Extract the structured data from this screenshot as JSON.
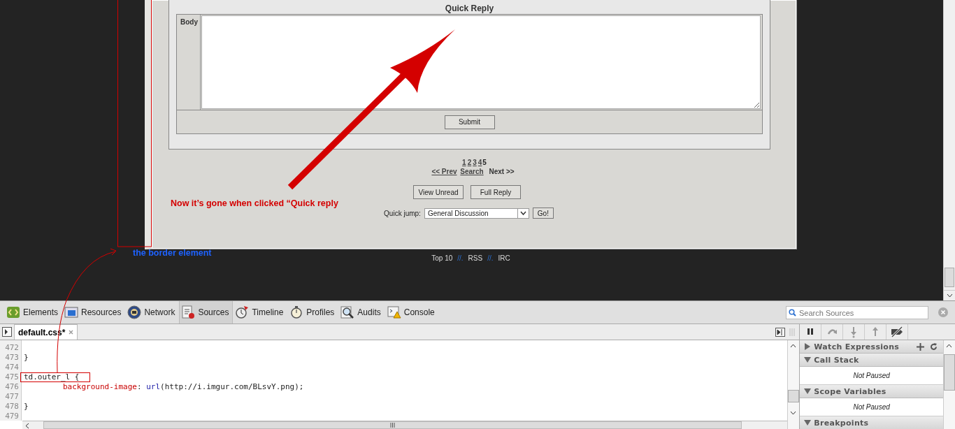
{
  "page": {
    "quick_reply": {
      "title": "Quick Reply",
      "body_label": "Body",
      "submit": "Submit"
    },
    "pages": [
      {
        "label": "1",
        "selected": false
      },
      {
        "label": "2",
        "selected": false
      },
      {
        "label": "3",
        "selected": false
      },
      {
        "label": "4",
        "selected": false
      },
      {
        "label": "5",
        "selected": true
      }
    ],
    "nav": [
      {
        "label": "<< Prev",
        "kind": "link"
      },
      {
        "label": "Search",
        "kind": "link"
      },
      {
        "label": "Next >>",
        "kind": "text"
      }
    ],
    "buttons": [
      "View Unread",
      "Full Reply"
    ],
    "quick_jump": {
      "label": "Quick jump:",
      "value": "General Discussion",
      "button": "Go!"
    },
    "footer": [
      {
        "label": "Top 10",
        "kind": "link"
      },
      {
        "label": "//.",
        "kind": "separator"
      },
      {
        "label": "RSS",
        "kind": "link"
      },
      {
        "label": "//.",
        "kind": "separator"
      },
      {
        "label": "IRC",
        "kind": "link"
      }
    ]
  },
  "annotations": {
    "note": "Now it’s gone when clicked “Quick reply",
    "border_label": "the border element"
  },
  "devtools": {
    "tabs": [
      {
        "label": "Elements",
        "selected": false
      },
      {
        "label": "Resources",
        "selected": false
      },
      {
        "label": "Network",
        "selected": false
      },
      {
        "label": "Sources",
        "selected": true
      },
      {
        "label": "Timeline",
        "selected": false
      },
      {
        "label": "Profiles",
        "selected": false
      },
      {
        "label": "Audits",
        "selected": false
      },
      {
        "label": "Console",
        "selected": false
      }
    ],
    "search": {
      "placeholder": "Search Sources"
    },
    "file_tab": "default.css*",
    "code_lines": [
      {
        "number": "472"
      },
      {
        "number": "473",
        "tokens": [
          {
            "text": "}",
            "kind": "plain"
          }
        ]
      },
      {
        "number": "474"
      },
      {
        "number": "475",
        "highlighted": true,
        "tokens": [
          {
            "text": "td.outer_l {",
            "kind": "plain"
          }
        ]
      },
      {
        "number": "476",
        "indented": true,
        "tokens": [
          {
            "text": "background-image",
            "kind": "property"
          },
          {
            "text": ": ",
            "kind": "plain"
          },
          {
            "text": "url",
            "kind": "value"
          },
          {
            "text": "(http://i.imgur.com/BLsvY.png);",
            "kind": "plain"
          }
        ]
      },
      {
        "number": "477"
      },
      {
        "number": "478",
        "tokens": [
          {
            "text": "}",
            "kind": "plain"
          }
        ]
      },
      {
        "number": "479"
      }
    ],
    "sections": [
      {
        "title": "Watch Expressions",
        "expanded": false
      },
      {
        "title": "Call Stack",
        "expanded": true,
        "content": "Not Paused"
      },
      {
        "title": "Scope Variables",
        "expanded": true,
        "content": "Not Paused"
      },
      {
        "title": "Breakpoints",
        "expanded": true
      }
    ]
  }
}
